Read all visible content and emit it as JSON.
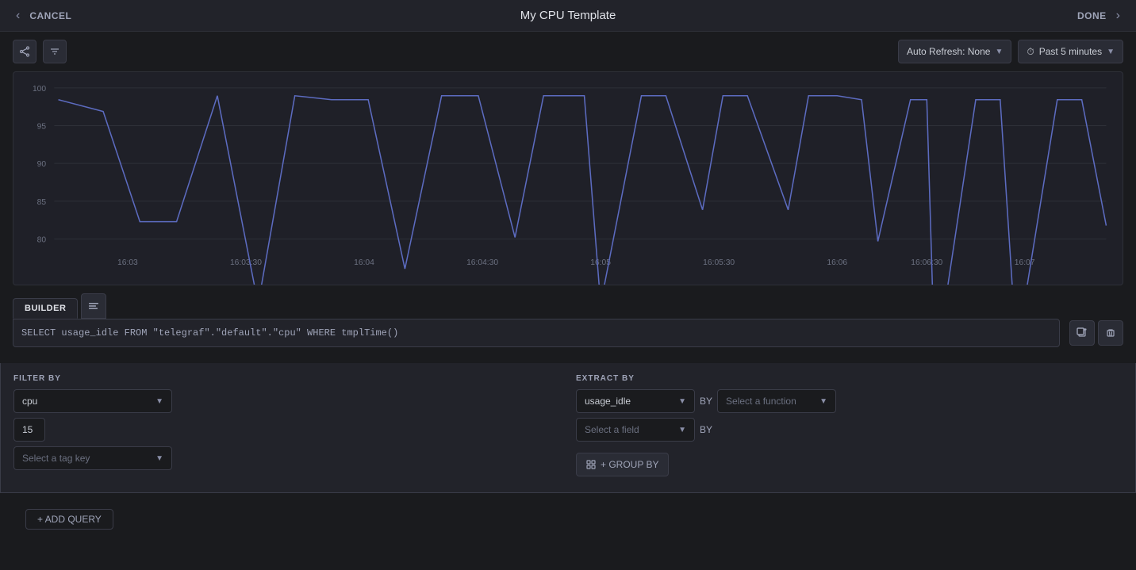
{
  "header": {
    "cancel_label": "CANCEL",
    "title": "My CPU Template",
    "done_label": "DONE"
  },
  "toolbar": {
    "share_icon": "↗",
    "edit_icon": "↕",
    "auto_refresh_label": "Auto Refresh: None",
    "time_range_label": "Past 5 minutes"
  },
  "chart": {
    "y_labels": [
      "100",
      "95",
      "90",
      "85",
      "80"
    ],
    "x_labels": [
      "16:03",
      "16:03:30",
      "16:04",
      "16:04:30",
      "16:05",
      "16:05:30",
      "16:06",
      "16:06:30",
      "16:07"
    ]
  },
  "query_editor": {
    "builder_tab_label": "BUILDER",
    "raw_tab_icon": "≡",
    "sql_text": "SELECT usage_idle FROM \"telegraf\".\"default\".\"cpu\" WHERE tmplTime()"
  },
  "filter_by": {
    "section_label": "FILTER BY",
    "measurement_value": "cpu",
    "tag_value": "15",
    "tag_key_placeholder": "Select a tag key"
  },
  "extract_by": {
    "section_label": "EXTRACT BY",
    "field_value": "usage_idle",
    "by_label_1": "BY",
    "function_placeholder": "Select a function",
    "field_placeholder": "Select a field",
    "by_label_2": "BY",
    "group_by_label": "+ GROUP BY"
  },
  "add_query_label": "+ ADD QUERY"
}
